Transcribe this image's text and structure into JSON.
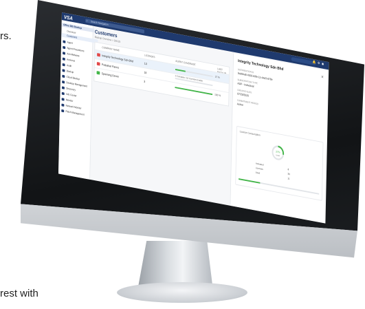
{
  "page_text": {
    "top_fragment": "rs.",
    "bottom_fragment": "rest with"
  },
  "app": {
    "logo": "VSA",
    "search_placeholder": "Search Navigation",
    "accent_color": "#1f3a6e",
    "success_color": "#43b649"
  },
  "sidebar": {
    "group": "Office 365 Backup",
    "items": [
      {
        "label": "Overview",
        "sub": true
      },
      {
        "label": "Customers",
        "sub": true,
        "active": true
      },
      {
        "label": "Agent"
      },
      {
        "label": "Agent Procedures"
      },
      {
        "label": "Anti-Malware"
      },
      {
        "label": "Antivirus"
      },
      {
        "label": "Audit"
      },
      {
        "label": "Backup"
      },
      {
        "label": "Cloud Backup"
      },
      {
        "label": "Desktop Management"
      },
      {
        "label": "Discovery"
      },
      {
        "label": "Info Center"
      },
      {
        "label": "Monitor"
      },
      {
        "label": "Network Monitor"
      },
      {
        "label": "Patch Management"
      }
    ]
  },
  "main": {
    "title": "Customers",
    "breadcrumb": "Backup Overview > 25/125",
    "columns": {
      "name": "COMPANY NAME",
      "agents": "LICENSES",
      "coverage": "AGENT COVERAGE",
      "date": "LAST BACKUP"
    },
    "rows": [
      {
        "name": "Integrity Technology Sdn Bhd",
        "badge_color": "#e24848",
        "agents": "13",
        "coverage": 0.27,
        "pct": "27 %",
        "date": "07/29/2020",
        "selected": true
      },
      {
        "name": "Prabakar Farms",
        "badge_color": "#e24848",
        "agents": "18",
        "coverage": 0.0,
        "pct": "",
        "note": "0 Complete / 18 Licenses Enable",
        "date": "07/29/2020"
      },
      {
        "name": "Spanning Demo",
        "badge_color": "#43b649",
        "agents": "3",
        "coverage": 1.0,
        "pct": "100 %",
        "date": "07/29/2020"
      }
    ]
  },
  "panel": {
    "title": "Integrity Technology Sdn Bhd",
    "fields": [
      {
        "label": "DISTRIBUTION ID",
        "value": "9cd6ba5-4100-b9fe-11-44d3-878e"
      },
      {
        "label": "SUBSCRIPTION TYPE",
        "value": "ADP - Individual"
      },
      {
        "label": "CREATED DATE",
        "value": "07/29/2020"
      },
      {
        "label": "COMMITMENT PERIOD",
        "value": "Active"
      }
    ],
    "card": {
      "title": "License Consumption",
      "percent": "27%",
      "percent_sub": "Used",
      "stats": [
        {
          "label": "Activated",
          "value": "8"
        },
        {
          "label": "Licenses",
          "value": "30"
        },
        {
          "label": "Used",
          "value": "11"
        }
      ]
    }
  }
}
